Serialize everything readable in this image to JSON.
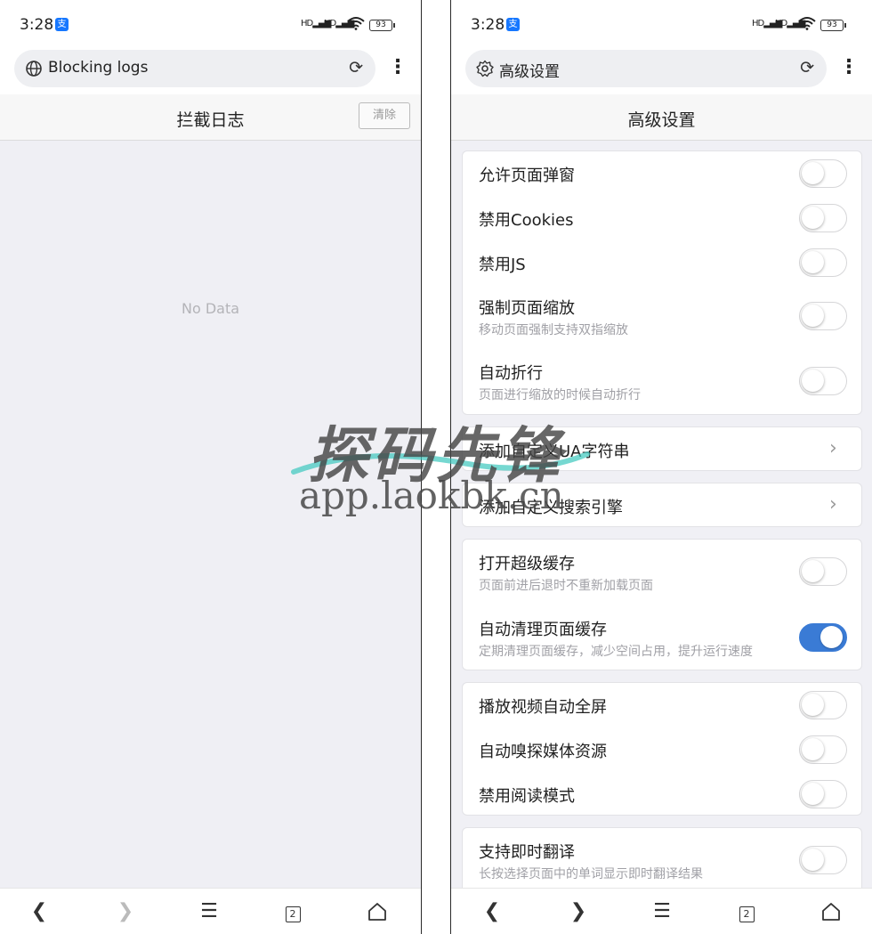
{
  "left": {
    "status": {
      "time": "3:28",
      "alipay": "支",
      "signal1": "HD",
      "signal2": "HD",
      "battery": "93"
    },
    "urlbar": {
      "url_text": "Blocking logs",
      "lead_icon": "globe-icon",
      "reload_icon": "refresh-icon",
      "menu": "⋮"
    },
    "header": {
      "title": "拦截日志",
      "clear_label": "清除"
    },
    "empty_text": "No Data",
    "bottom_nav": {
      "tabs_count": "2"
    }
  },
  "right": {
    "status": {
      "time": "3:28",
      "alipay": "支",
      "signal1": "HD",
      "signal2": "HD",
      "battery": "93"
    },
    "urlbar": {
      "url_text": "高级设置",
      "lead_icon": "gear-icon",
      "reload_icon": "refresh-icon",
      "menu": "⋮"
    },
    "header": {
      "title": "高级设置"
    },
    "settings": {
      "allow_popups": {
        "label": "允许页面弹窗",
        "enabled": false
      },
      "disable_cookies": {
        "label": "禁用Cookies",
        "enabled": false
      },
      "disable_js": {
        "label": "禁用JS",
        "enabled": false
      },
      "force_zoom": {
        "label": "强制页面缩放",
        "desc": "移动页面强制支持双指缩放",
        "enabled": false
      },
      "auto_wrap": {
        "label": "自动折行",
        "desc": "页面进行缩放的时候自动折行",
        "enabled": false
      },
      "custom_ua": {
        "label": "添加自定义UA字符串"
      },
      "custom_search": {
        "label": "添加自定义搜索引擎"
      },
      "super_cache": {
        "label": "打开超级缓存",
        "desc": "页面前进后退时不重新加载页面",
        "enabled": false
      },
      "auto_clear_cache": {
        "label": "自动清理页面缓存",
        "desc": "定期清理页面缓存，减少空间占用，提升运行速度",
        "enabled": true
      },
      "video_fullscreen": {
        "label": "播放视频自动全屏",
        "enabled": false
      },
      "sniff_media": {
        "label": "自动嗅探媒体资源",
        "enabled": false
      },
      "disable_reader": {
        "label": "禁用阅读模式",
        "enabled": false
      },
      "instant_translate": {
        "label": "支持即时翻译",
        "desc": "长按选择页面中的单词显示即时翻译结果",
        "enabled": false
      }
    },
    "bottom_nav": {
      "tabs_count": "2"
    }
  },
  "watermark": {
    "title": "探码先锋",
    "url": "app.laokbk.cn"
  },
  "colors": {
    "accent": "#3a7bd5",
    "page_bg": "#f0f0f5",
    "muted_text": "#a0a0a6"
  }
}
